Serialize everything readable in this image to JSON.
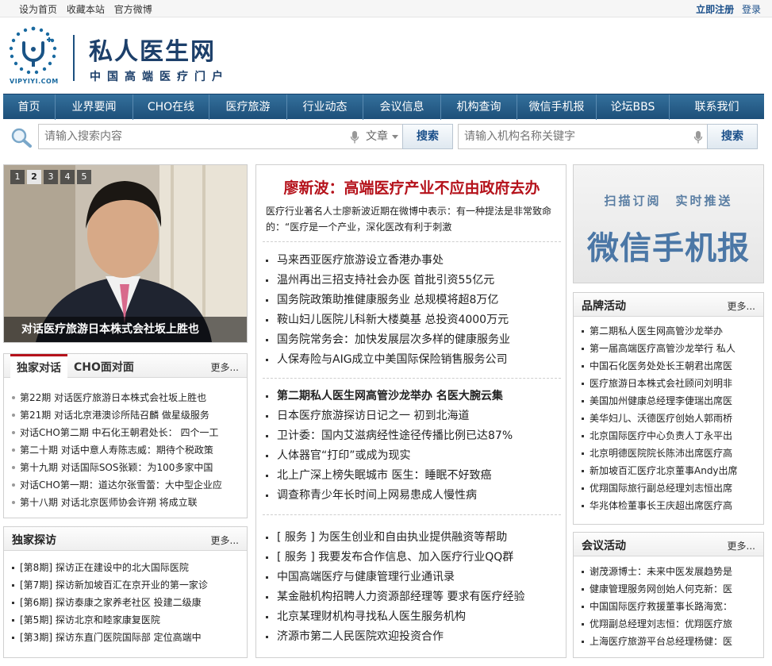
{
  "topbar": {
    "left_links": [
      "设为首页",
      "收藏本站",
      "官方微博"
    ],
    "register": "立即注册",
    "login": "登录"
  },
  "logo": {
    "title": "私人医生网",
    "subtitle": "中国高端医疗门户",
    "url": "VIPYIYI.COM"
  },
  "nav": {
    "items": [
      "首页",
      "业界要闻",
      "CHO在线",
      "医疗旅游",
      "行业动态",
      "会议信息",
      "机构查询",
      "微信手机报",
      "论坛BBS",
      "联系我们"
    ]
  },
  "search": {
    "placeholder": "请输入搜索内容",
    "category": "文章",
    "button": "搜索",
    "org_placeholder": "请输入机构名称关键字",
    "org_button": "搜索"
  },
  "slider": {
    "numbers": [
      "1",
      "2",
      "3",
      "4",
      "5"
    ],
    "active": "2",
    "caption": "对话医疗旅游日本株式会社坂上胜也"
  },
  "dialog_panel": {
    "tabs": [
      "独家对话",
      "CHO面对面"
    ],
    "more": "更多...",
    "items": [
      "第22期 对话医疗旅游日本株式会社坂上胜也",
      "第21期 对话北京港澳诊所陆召麟 做星级服务",
      "对话CHO第二期 中石化王朝君处长： 四个一工",
      "第二十期 对话中意人寿陈志威：期待个税政策",
      "第十九期 对话国际SOS张颖：为100多家中国",
      "对话CHO第一期：道达尔张雪蕾：大中型企业应",
      "第十八期 对话北京医师协会许朔 将成立联"
    ]
  },
  "visit_panel": {
    "title": "独家探访",
    "more": "更多...",
    "items": [
      "[第8期] 探访正在建设中的北大国际医院",
      "[第7期] 探访新加坡百汇在京开业的第一家诊",
      "[第6期] 探访泰康之家养老社区 投建二级康",
      "[第5期] 探访北京和睦家康复医院",
      "[第3期] 探访东直门医院国际部 定位高端中"
    ]
  },
  "center": {
    "headline": "廖新波：高端医疗产业不应由政府去办",
    "summary": "医疗行业著名人士廖新波近期在微博中表示：有一种提法是非常致命的：“医疗是一个产业，深化医改有利于刺激",
    "group1": [
      "马来西亚医疗旅游设立香港办事处",
      "温州再出三招支持社会办医 首批引资55亿元",
      "国务院政策助推健康服务业 总规模将超8万亿",
      "鞍山妇儿医院儿科新大楼奠基 总投资4000万元",
      "国务院常务会：加快发展层次多样的健康服务业",
      "人保寿险与AIG成立中美国际保险销售服务公司"
    ],
    "group2": [
      "第二期私人医生网高管沙龙举办 名医大腕云集",
      "日本医疗旅游探访日记之一 初到北海道",
      "卫计委：国内艾滋病经性途径传播比例已达87%",
      "人体器官“打印”或成为现实",
      "北上广深上榜失眠城市 医生：睡眠不好致癌",
      "调查称青少年长时间上网易患成人慢性病"
    ],
    "group3": [
      "[ 服务 ] 为医生创业和自由执业提供融资等帮助",
      "[ 服务 ] 我要发布合作信息、加入医疗行业QQ群",
      "中国高端医疗与健康管理行业通讯录",
      "某金融机构招聘人力资源部经理等 要求有医疗经验",
      "北京某理财机构寻找私人医生服务机构",
      "济源市第二人民医院欢迎投资合作"
    ]
  },
  "wechat": {
    "line1": "扫描订阅　实时推送",
    "line2": "微信手机报"
  },
  "brand_panel": {
    "title": "品牌活动",
    "more": "更多...",
    "items": [
      "第二期私人医生网高管沙龙举办",
      "第一届高端医疗高管沙龙举行 私人",
      "中国石化医务处处长王朝君出席医",
      "医疗旅游日本株式会社顾问刘明非",
      "美国加州健康总经理李倢瑞出席医",
      "美华妇儿、沃德医疗创始人郭雨桥",
      "北京国际医疗中心负责人丁永平出",
      "北京明德医院院长陈沛出席医疗高",
      "新加坡百汇医疗北京董事Andy出席",
      "优翔国际旅行副总经理刘志恒出席",
      "华兆体检董事长王庆超出席医疗高"
    ]
  },
  "meeting_panel": {
    "title": "会议活动",
    "more": "更多...",
    "items": [
      "谢茂源博士：未来中医发展趋势是",
      "健康管理服务网创始人何克新：医",
      "中国国际医疗救援董事长路海宽：",
      "优翔副总经理刘志恒：优翔医疗旅",
      "上海医疗旅游平台总经理杨健：医"
    ]
  },
  "colors": {
    "nav_bg": "#1d4f79",
    "headline_red": "#b5121b",
    "logo_blue": "#1c3f6a"
  }
}
